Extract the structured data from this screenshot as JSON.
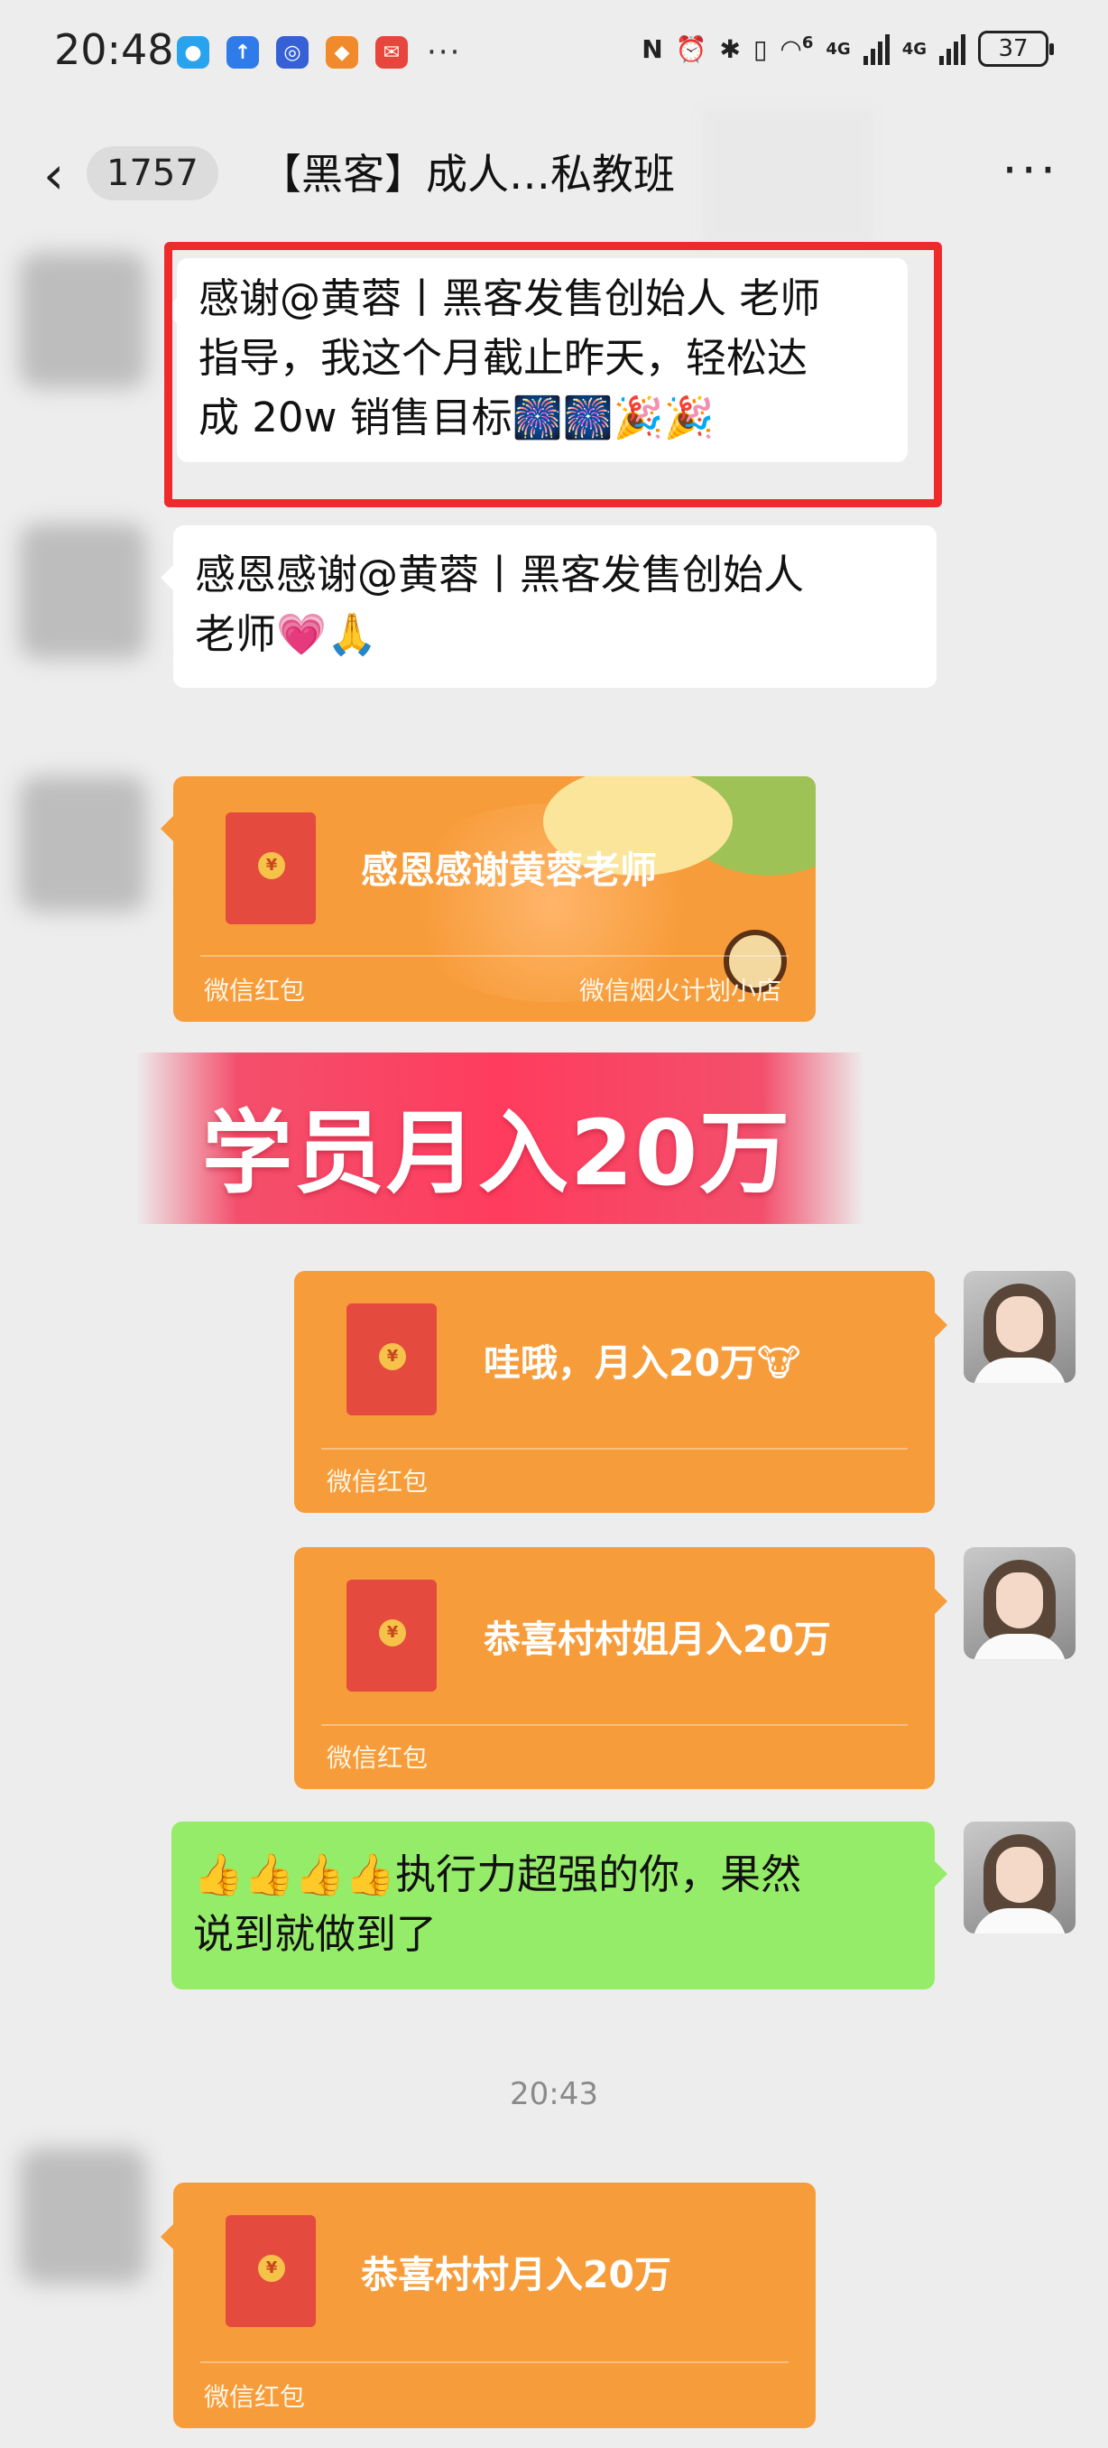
{
  "status_bar": {
    "time": "20:48",
    "more": "···",
    "signal_a": "4G",
    "signal_b": "4G",
    "wifi_badge": "6",
    "battery": "37"
  },
  "header": {
    "back_count": "1757",
    "title": "【黑客】成人…私教班",
    "more": "···"
  },
  "messages": {
    "m1": {
      "lines": [
        "感谢@黄蓉丨黑客发售创始人  老师",
        "指导，我这个月截止昨天，轻松达",
        "成 20w 销售目标🎆🎆🎉🎉"
      ]
    },
    "m2": {
      "lines": [
        "感恩感谢@黄蓉丨黑客发售创始人",
        "老师💗🙏"
      ]
    },
    "p1": {
      "text": "感恩感谢黄蓉老师",
      "label": "微信红包",
      "store": "微信烟火计划小店"
    },
    "banner": "学员月入20万",
    "p2": {
      "text": "哇哦，月入20万🐮",
      "label": "微信红包"
    },
    "p3": {
      "text": "恭喜村村姐月入20万",
      "label": "微信红包"
    },
    "m3": {
      "lines": [
        "👍👍👍👍执行力超强的你，果然",
        "说到就做到了"
      ]
    },
    "timestamp": "20:43",
    "p4": {
      "text": "恭喜村村月入20万",
      "label": "微信红包"
    }
  },
  "colors": {
    "background": "#ededed",
    "packet_orange": "#f79c3a",
    "my_bubble_green": "#95ec69",
    "highlight_red": "#ee2a2a",
    "banner_red": "#ff3c5e"
  },
  "icons": [
    "back-chevron-icon",
    "more-icon",
    "red-packet-icon",
    "wifi-icon",
    "battery-icon",
    "nfc-icon",
    "alarm-icon",
    "bluetooth-icon",
    "vibrate-icon"
  ]
}
